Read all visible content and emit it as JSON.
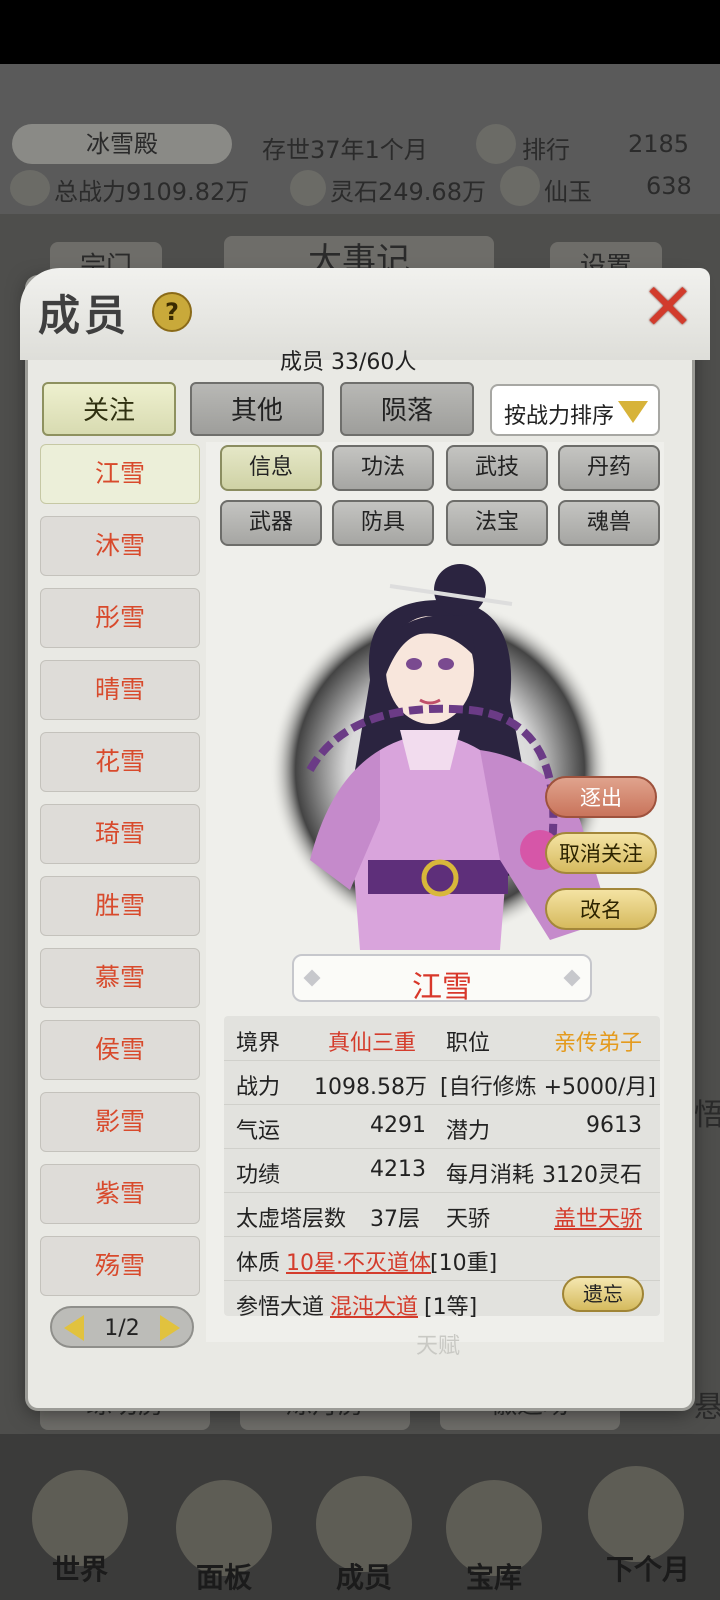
{
  "header": {
    "sect_name": "冰雪殿",
    "time": "存世37年1个月",
    "rank_label": "排行",
    "rank_value": "2185",
    "total_power": "总战力9109.82万",
    "spirit_stone": "灵石249.68万",
    "jade_label": "仙玉",
    "jade_value": "638"
  },
  "background": {
    "left_btn": "宗门",
    "center_btn": "大事记",
    "right_btn": "设置",
    "side_right": "悟",
    "mid_labels": [
      "练功房",
      "炼丹房",
      "徽道场"
    ],
    "side_right2": "悬"
  },
  "bottom_nav": [
    "世界",
    "面板",
    "成员",
    "宝库",
    "下个月"
  ],
  "modal": {
    "title": "成员",
    "help": "?",
    "close": "✕",
    "member_count": "成员  33/60人",
    "tabs": [
      "关注",
      "其他",
      "陨落"
    ],
    "sort_label": "按战力排序",
    "members": [
      "江雪",
      "沐雪",
      "彤雪",
      "晴雪",
      "花雪",
      "琦雪",
      "胜雪",
      "慕雪",
      "侯雪",
      "影雪",
      "紫雪",
      "殇雪"
    ],
    "subtabs": [
      "信息",
      "功法",
      "武技",
      "丹药",
      "武器",
      "防具",
      "法宝",
      "魂兽"
    ],
    "actions": [
      "逐出",
      "取消关注",
      "改名"
    ],
    "name": "江雪",
    "stats": {
      "realm_label": "境界",
      "realm": "真仙三重",
      "position_label": "职位",
      "position": "亲传弟子",
      "power_label": "战力",
      "power": "1098.58万",
      "training": "[自行修炼 +5000/月]",
      "luck_label": "气运",
      "luck": "4291",
      "potential_label": "潜力",
      "potential": "9613",
      "merit_label": "功绩",
      "merit": "4213",
      "monthly_label": "每月消耗",
      "monthly": "3120灵石",
      "tower_label": "太虚塔层数",
      "tower": "37层",
      "talent_label": "天骄",
      "talent": "盖世天骄",
      "physique_label": "体质",
      "physique": "10星·不灭道体",
      "physique_level": "[10重]",
      "dao_label": "参悟大道",
      "dao": "混沌大道",
      "dao_level": "[1等]"
    },
    "forget": "遗忘",
    "faint_label": "天赋",
    "pager": "1/2"
  }
}
